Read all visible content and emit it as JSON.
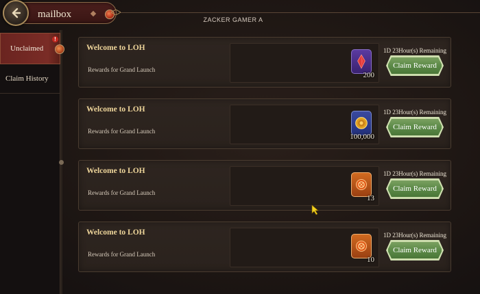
{
  "header": {
    "title": "mailbox",
    "player_name": "ZACKER GAMER A"
  },
  "sidebar": {
    "tabs": [
      {
        "label": "Unclaimed",
        "active": true,
        "alert": "!"
      },
      {
        "label": "Claim History",
        "active": false
      }
    ]
  },
  "mails": [
    {
      "title": "Welcome to LOH",
      "subtitle": "Rewards for Grand Launch",
      "item": {
        "icon": "red-crystal-icon",
        "count": "200"
      },
      "remaining": "1D 23Hour(s) Remaining",
      "claim_label": "Claim Reward"
    },
    {
      "title": "Welcome to LOH",
      "subtitle": "Rewards for Grand Launch",
      "item": {
        "icon": "gold-coin-icon",
        "count": "100,000"
      },
      "remaining": "1D 23Hour(s) Remaining",
      "claim_label": "Claim Reward"
    },
    {
      "title": "Welcome to LOH",
      "subtitle": "Rewards for Grand Launch",
      "item": {
        "icon": "orange-token-icon",
        "count": "13"
      },
      "remaining": "1D 23Hour(s) Remaining",
      "claim_label": "Claim Reward"
    },
    {
      "title": "Welcome to LOH",
      "subtitle": "Rewards for Grand Launch",
      "item": {
        "icon": "orange-token-icon",
        "count": "10"
      },
      "remaining": "1D 23Hour(s) Remaining",
      "claim_label": "Claim Reward"
    }
  ],
  "colors": {
    "accent_red": "#6a2420",
    "claim_green": "#5c8a48",
    "title_gold": "#eed59a"
  }
}
